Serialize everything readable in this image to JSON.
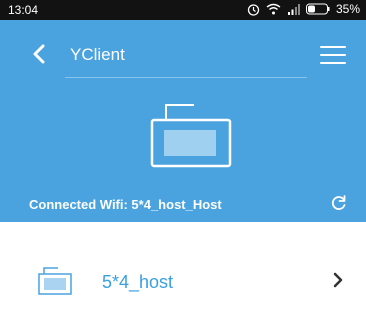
{
  "status_bar": {
    "time": "13:04",
    "battery": "35%"
  },
  "header": {
    "title": "YClient",
    "connected_wifi": "Connected Wifi: 5*4_host_Host"
  },
  "devices": [
    {
      "name": "5*4_host"
    }
  ],
  "icons": {
    "back": "back-arrow-icon",
    "menu": "hamburger-menu-icon",
    "refresh": "refresh-icon",
    "device": "device-icon",
    "chevron": "chevron-right-icon"
  },
  "colors": {
    "header_bg": "#4aa3df",
    "accent": "#3aa0e0",
    "status_bar_bg": "#121212"
  }
}
